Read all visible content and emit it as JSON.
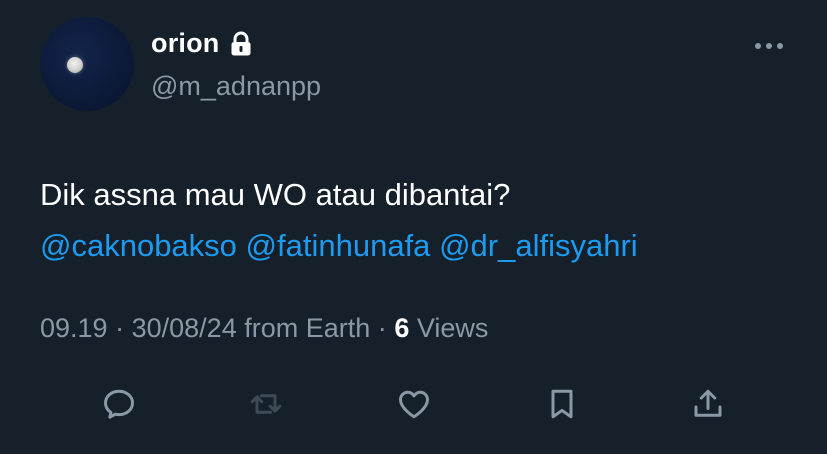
{
  "author": {
    "display_name": "orion",
    "handle": "@m_adnanpp",
    "protected_icon": "lock-icon",
    "avatar": "moon-night-sky"
  },
  "tweet": {
    "text": "Dik assna mau WO atau dibantai?",
    "mentions": [
      "@caknobakso",
      "@fatinhunafa",
      "@dr_alfisyahri"
    ]
  },
  "meta": {
    "time": "09.19",
    "separator": "·",
    "date": "30/08/24",
    "source": "from Earth",
    "views_count": "6",
    "views_label": "Views"
  },
  "actions": {
    "reply_icon": "reply-icon",
    "retweet_icon": "retweet-icon",
    "like_icon": "like-icon",
    "bookmark_icon": "bookmark-icon",
    "share_icon": "share-icon"
  },
  "colors": {
    "background": "#15202b",
    "link": "#1d9bf0",
    "secondary_text": "#8b98a5",
    "retweet_disabled": "#3e4a56"
  }
}
